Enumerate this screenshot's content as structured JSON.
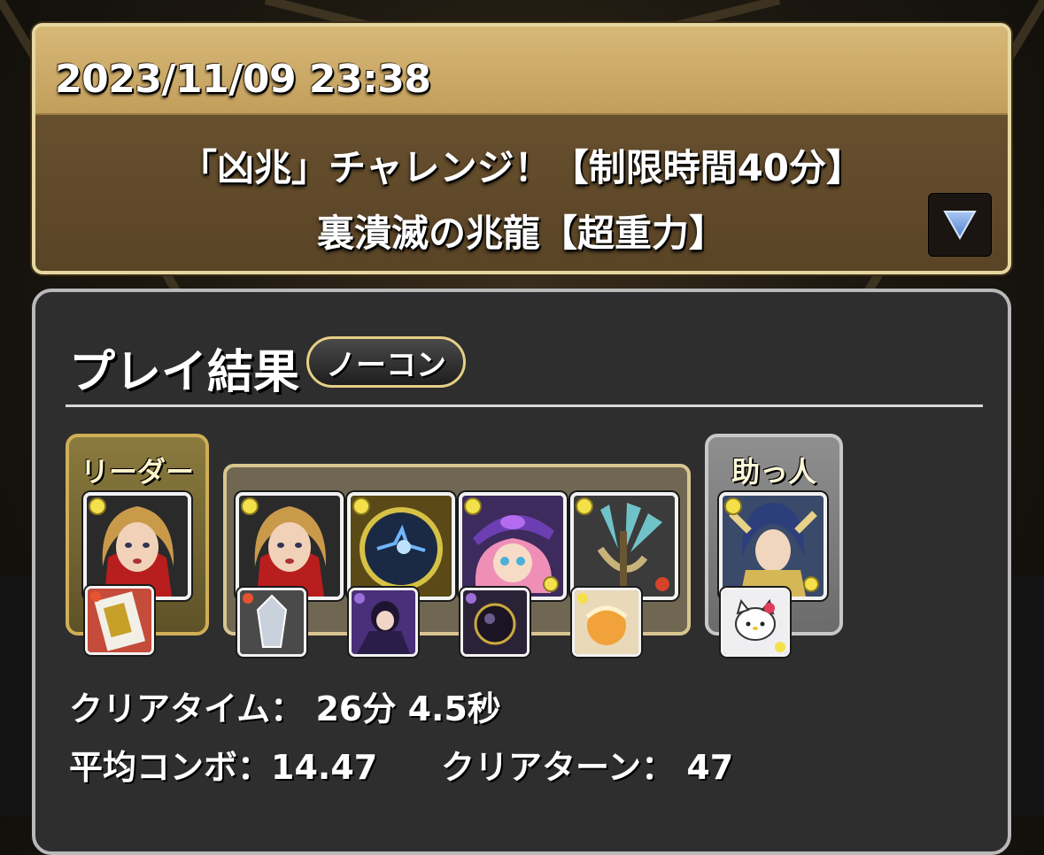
{
  "header": {
    "date": "2023/11/09 23:38",
    "dungeon_title": "「凶兆」チャレンジ！【制限時間40分】",
    "dungeon_subtitle": "裏潰滅の兆龍【超重力】"
  },
  "result": {
    "title": "プレイ結果",
    "badge": "ノーコン",
    "leader_label": "リーダー",
    "helper_label": "助っ人",
    "stats": {
      "clear_time_label": "クリアタイム：",
      "clear_time_value": "26分 4.5秒",
      "avg_combo_label": "平均コンボ：",
      "avg_combo_value": "14.47",
      "clear_turn_label": "クリアターン：",
      "clear_turn_value": "47"
    }
  },
  "colors": {
    "header_gold": "#d8b877",
    "header_brown": "#5a4426",
    "panel_bg": "#2e2e2e",
    "leader_frame": "#cfae56",
    "helper_frame": "#c8c8c8",
    "expand_arrow": "#7fa6e0"
  },
  "icons": {
    "expand": "triangle-down-icon",
    "attribute": "light-orb-icon"
  }
}
